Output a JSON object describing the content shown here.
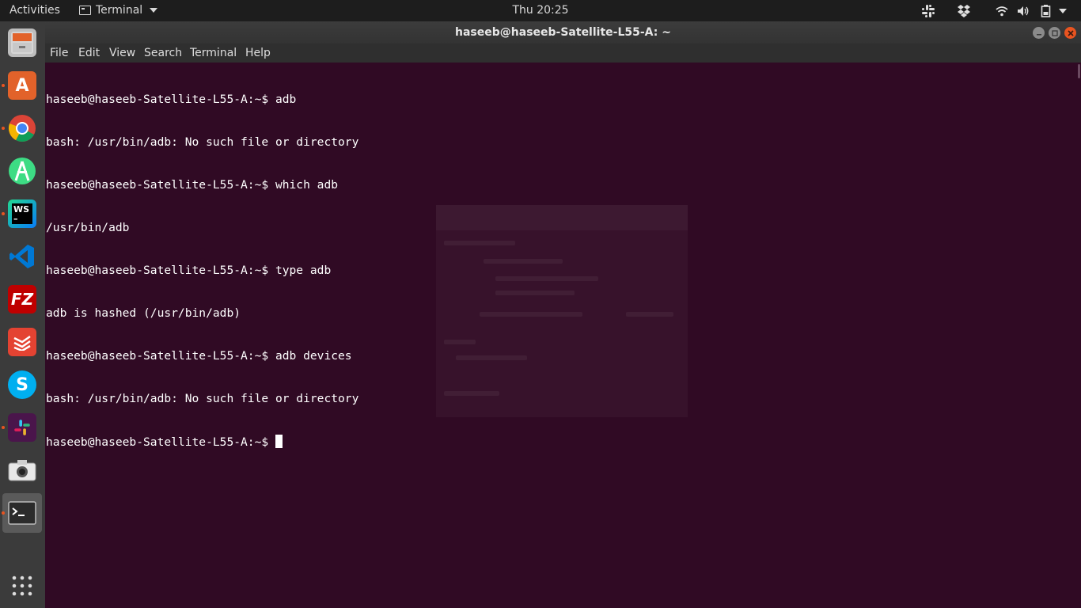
{
  "topbar": {
    "activities": "Activities",
    "app_name": "Terminal",
    "clock": "Thu 20:25",
    "tray_icons": [
      "slack-icon",
      "dropbox-icon",
      "wifi-icon",
      "volume-icon",
      "battery-icon",
      "chevron-down-icon"
    ]
  },
  "dock": {
    "items": [
      {
        "name": "files",
        "icon": "file-cabinet-icon",
        "running": false
      },
      {
        "name": "software-center",
        "icon": "shopping-bag-icon",
        "running": true
      },
      {
        "name": "chrome",
        "icon": "chrome-icon",
        "running": true
      },
      {
        "name": "android-studio",
        "icon": "android-studio-icon",
        "running": false
      },
      {
        "name": "webstorm",
        "icon": "webstorm-icon",
        "label": "WS",
        "running": true
      },
      {
        "name": "vscode",
        "icon": "vscode-icon",
        "running": false
      },
      {
        "name": "filezilla",
        "icon": "filezilla-icon",
        "label": "FZ",
        "running": false
      },
      {
        "name": "todoist",
        "icon": "todoist-icon",
        "running": false
      },
      {
        "name": "skype",
        "icon": "skype-icon",
        "label": "S",
        "running": false
      },
      {
        "name": "slack",
        "icon": "slack-icon",
        "running": true
      },
      {
        "name": "screenshot",
        "icon": "camera-icon",
        "running": false
      },
      {
        "name": "terminal",
        "icon": "terminal-icon",
        "running": true,
        "active": true
      }
    ],
    "show_apps_icon": "grid-icon"
  },
  "window": {
    "title": "haseeb@haseeb-Satellite-L55-A: ~",
    "menu": [
      "File",
      "Edit",
      "View",
      "Search",
      "Terminal",
      "Help"
    ]
  },
  "terminal": {
    "lines": [
      "haseeb@haseeb-Satellite-L55-A:~$ adb",
      "bash: /usr/bin/adb: No such file or directory",
      "haseeb@haseeb-Satellite-L55-A:~$ which adb",
      "/usr/bin/adb",
      "haseeb@haseeb-Satellite-L55-A:~$ type adb",
      "adb is hashed (/usr/bin/adb)",
      "haseeb@haseeb-Satellite-L55-A:~$ adb devices",
      "bash: /usr/bin/adb: No such file or directory",
      "haseeb@haseeb-Satellite-L55-A:~$ "
    ]
  },
  "colors": {
    "terminal_bg": "#300a24",
    "topbar_bg": "#1d1d1d",
    "dock_bg": "#3b3b3b",
    "accent": "#e95420",
    "close_button": "#e95420"
  }
}
